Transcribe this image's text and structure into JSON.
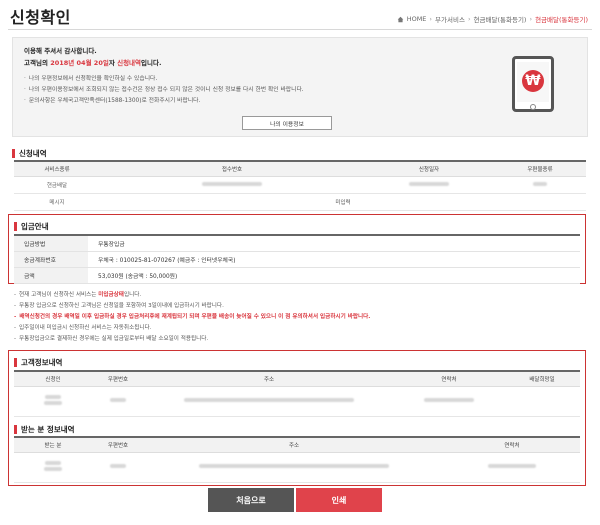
{
  "header": {
    "title": "신청확인",
    "breadcrumb": [
      "HOME",
      "부가서비스",
      "현금배달(통화등기)",
      "현금배달(통화등기)"
    ]
  },
  "notice": {
    "line1": "이용해 주셔서 감사합니다.",
    "line2_prefix": "고객님의 ",
    "line2_date": "2018년 04월 20일",
    "line2_mid": "자 ",
    "line2_status": "신청내역",
    "line2_suffix": "입니다.",
    "bullets": [
      "나의 우편정보에서 신청확인을 확인하실 수 있습니다.",
      "나의 우편이용정보에서 조회되지 않는 접수건은 정상 접수 되지 않은 것이니 신청 정보를 다시 한번 확인 바랍니다.",
      "문의사항은 우체국고객만족센터(1588-1300)로 전화주시기 바랍니다."
    ],
    "myinfo_button": "나의 이용정보"
  },
  "colors": {
    "accent": "#d9363e"
  },
  "application": {
    "title": "신청내역",
    "headers": [
      "서비스종류",
      "접수번호",
      "신청일자",
      "우편물종류"
    ],
    "row": {
      "service": "현금배달"
    },
    "memo_label": "메시지",
    "memo_value": "미입력"
  },
  "payment": {
    "title": "입금안내",
    "rows": [
      {
        "key": "입금방법",
        "value": "무통장입금"
      },
      {
        "key": "송금계좌번호",
        "value": "우체국 : 010025-81-070267 (예금주 : 인터넷우체국)"
      },
      {
        "key": "금액",
        "value": "53,030원 (송금액 : 50,000원)"
      }
    ]
  },
  "notes": {
    "line1_prefix": "현재 고객님이 신청하신 서비스는 ",
    "line1_status": "미입금상태",
    "line1_suffix": "입니다.",
    "line2": "무통장 입금으로 신청하신 고객님은 신청일을 포함하여 3일이내에 입금하시기 바랍니다.",
    "line3": "배역신청건의 경우 배역일 이후 입금하실 경우 입금처리후에 재계됩되기 되며 우편물 배송이 늦어질 수 있으니 이 점 유의하셔서 입금하시기 바랍니다.",
    "line4": "입주일이내 미입금시 신청하신 서비스는 자동취소됩니다.",
    "line5": "무통장입금으로 결제하신 경우에는 실제 입금일로부터 배달 소요일이 적용됩니다."
  },
  "customer": {
    "title": "고객정보내역",
    "headers": [
      "신청인",
      "우편번호",
      "주소",
      "연락처",
      "배달희망일"
    ]
  },
  "recipient": {
    "title": "받는 분 정보내역",
    "headers": [
      "받는 분",
      "우편번호",
      "주소",
      "연락처"
    ]
  },
  "buttons": {
    "first": "처음으로",
    "print": "인쇄"
  }
}
